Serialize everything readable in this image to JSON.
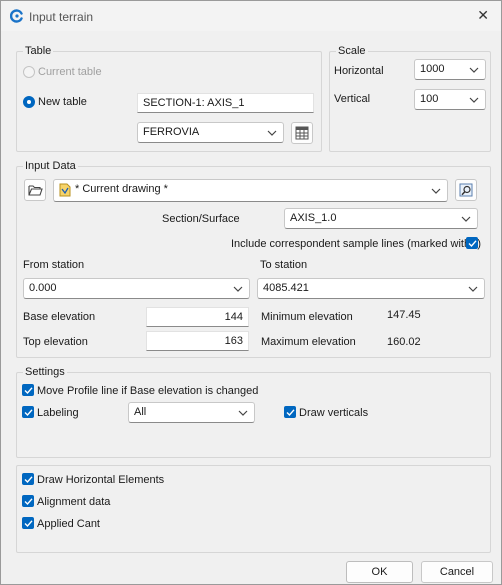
{
  "window": {
    "title": "Input terrain"
  },
  "table": {
    "legend": "Table",
    "current_table_label": "Current table",
    "new_table_label": "New table",
    "new_table_name": "SECTION-1: AXIS_1",
    "layer_value": "FERROVIA"
  },
  "scale": {
    "legend": "Scale",
    "horizontal_label": "Horizontal",
    "horizontal_value": "1000",
    "vertical_label": "Vertical",
    "vertical_value": "100"
  },
  "input_data": {
    "legend": "Input Data",
    "drawing_value": "* Current drawing *",
    "section_surface_label": "Section/Surface",
    "section_surface_value": "AXIS_1.0",
    "include_sample_lines_label": "Include correspondent sample lines (marked with *)",
    "from_station_label": "From station",
    "from_station_value": "0.000",
    "to_station_label": "To station",
    "to_station_value": "4085.421",
    "base_elevation_label": "Base elevation",
    "base_elevation_value": "144",
    "top_elevation_label": "Top elevation",
    "top_elevation_value": "163",
    "min_elevation_label": "Minimum elevation",
    "min_elevation_value": "147.45",
    "max_elevation_label": "Maximum elevation",
    "max_elevation_value": "160.02"
  },
  "settings": {
    "legend": "Settings",
    "move_profile_label": "Move Profile line if Base elevation is changed",
    "labeling_label": "Labeling",
    "labeling_value": "All",
    "draw_verticals_label": "Draw verticals"
  },
  "options": {
    "draw_horizontal_label": "Draw Horizontal Elements",
    "alignment_data_label": "Alignment data",
    "applied_cant_label": "Applied Cant"
  },
  "buttons": {
    "ok": "OK",
    "cancel": "Cancel"
  },
  "colors": {
    "accent": "#0067c0",
    "background": "#f0f0f0"
  },
  "icons": [
    "app-logo-icon",
    "close-icon",
    "chevron-down-icon",
    "table-grid-icon",
    "folder-open-icon",
    "drawing-file-icon",
    "zoom-pick-icon",
    "checkmark-icon"
  ]
}
